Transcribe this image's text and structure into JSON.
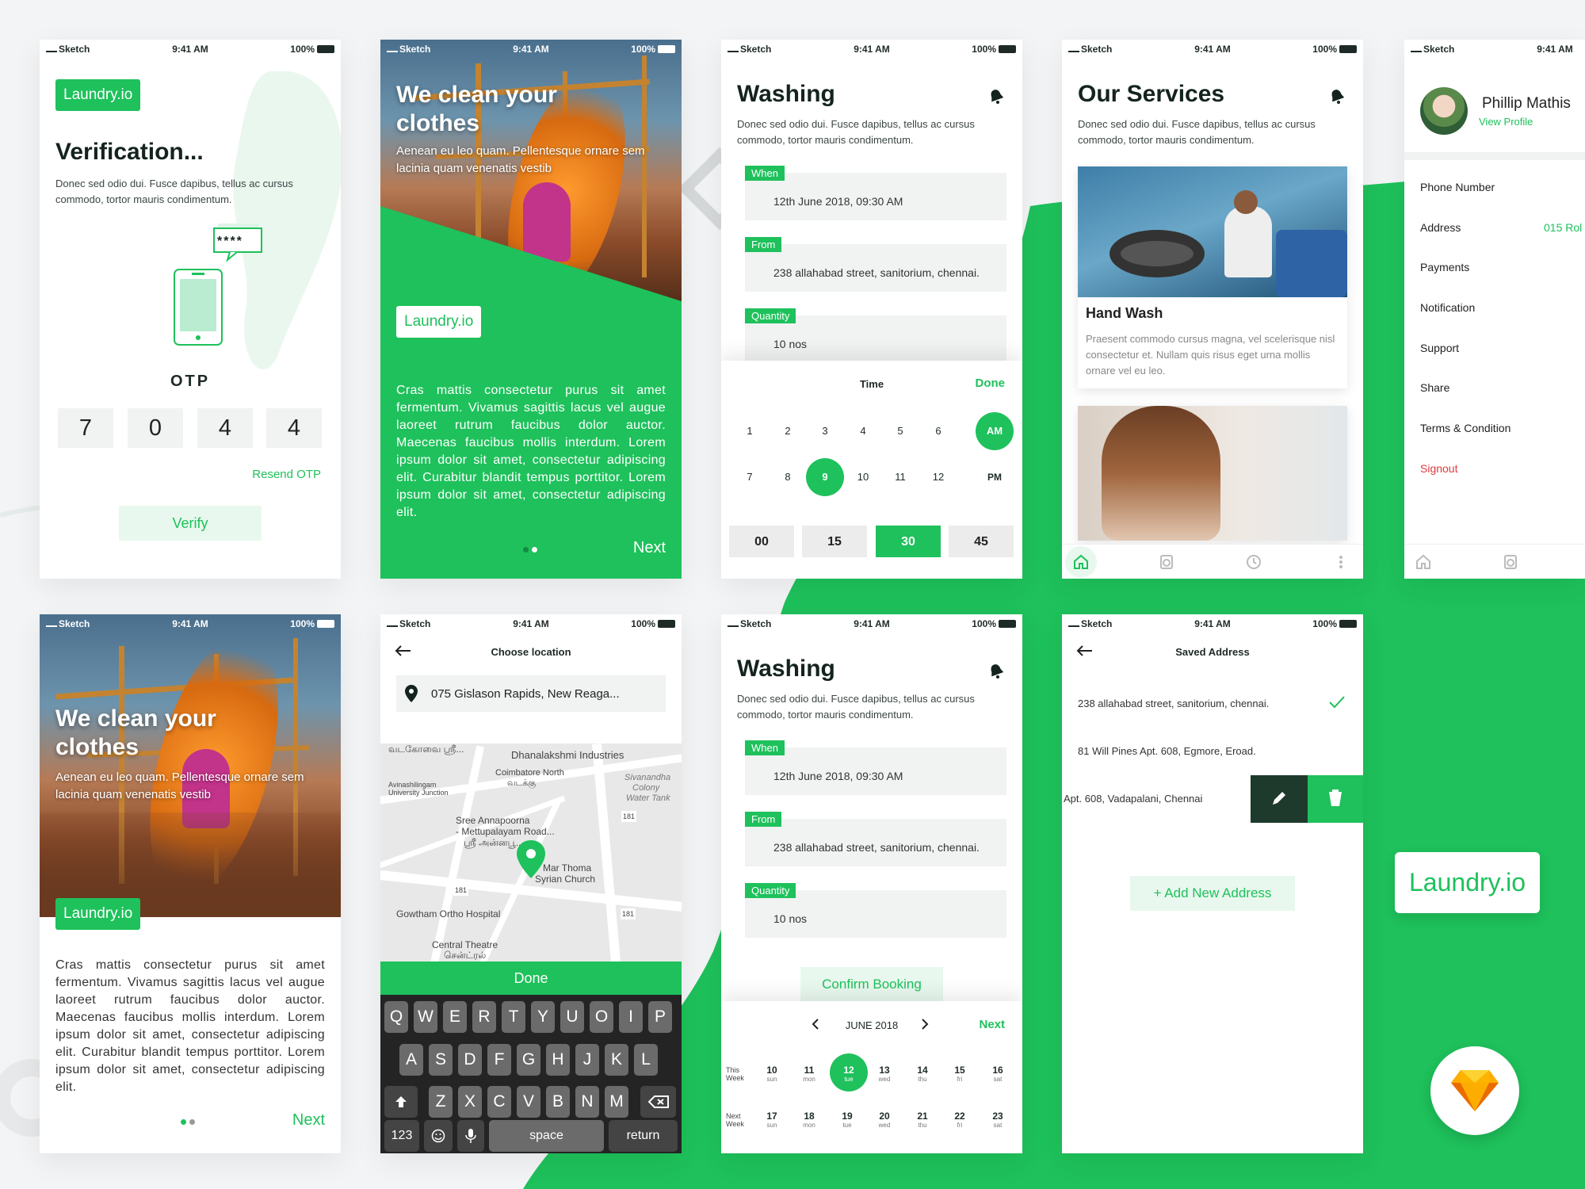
{
  "status_bar": {
    "carrier": "Sketch",
    "time": "9:41 AM",
    "battery": "100%"
  },
  "brand": {
    "logo": "Laundry.io",
    "accent": "#1ec15b",
    "dark": "#14231f"
  },
  "lorem_short": "Donec sed odio dui. Fusce dapibus, tellus ac cursus commodo, tortor mauris condimentum.",
  "lorem_long": "Cras mattis consectetur purus sit amet fermentum. Vivamus sagittis lacus vel augue laoreet rutrum faucibus dolor auctor. Maecenas faucibus mollis interdum. Lorem ipsum dolor sit amet, consectetur adipiscing elit. Curabitur blandit tempus porttitor. Lorem ipsum dolor sit amet, consectetur adipiscing elit.",
  "verification": {
    "title": "Verification...",
    "otp_label": "OTP",
    "otp_icon": "****",
    "digits": [
      "7",
      "0",
      "4",
      "4"
    ],
    "resend": "Resend OTP",
    "verify": "Verify"
  },
  "onboarding": {
    "title_line1": "We clean your",
    "title_line2": "clothes",
    "subtitle": "Aenean eu leo quam. Pellentesque ornare sem lacinia quam venenatis vestib",
    "next": "Next"
  },
  "booking": {
    "title": "Washing",
    "when_label": "When",
    "when_value": "12th June 2018, 09:30 AM",
    "from_label": "From",
    "from_value": "238 allahabad street,  sanitorium, chennai.",
    "qty_label": "Quantity",
    "qty_value": "10 nos",
    "time_title": "Time",
    "done": "Done",
    "hours_row1": [
      "1",
      "2",
      "3",
      "4",
      "5",
      "6"
    ],
    "hours_row2": [
      "7",
      "8",
      "9",
      "10",
      "11",
      "12"
    ],
    "am": "AM",
    "pm": "PM",
    "minutes": [
      "00",
      "15",
      "30",
      "45"
    ],
    "confirm": "Confirm Booking",
    "month": "JUNE 2018",
    "next": "Next",
    "week1_label_a": "This",
    "week1_label_b": "Week",
    "week2_label_a": "Next",
    "week2_label_b": "Week",
    "week1": [
      {
        "d": "10",
        "w": "sun"
      },
      {
        "d": "11",
        "w": "mon"
      },
      {
        "d": "12",
        "w": "tue"
      },
      {
        "d": "13",
        "w": "wed"
      },
      {
        "d": "14",
        "w": "thu"
      },
      {
        "d": "15",
        "w": "fri"
      },
      {
        "d": "16",
        "w": "sat"
      }
    ],
    "week2": [
      {
        "d": "17",
        "w": "sun"
      },
      {
        "d": "18",
        "w": "mon"
      },
      {
        "d": "19",
        "w": "tue"
      },
      {
        "d": "20",
        "w": "wed"
      },
      {
        "d": "21",
        "w": "thu"
      },
      {
        "d": "22",
        "w": "fri"
      },
      {
        "d": "23",
        "w": "sat"
      }
    ]
  },
  "services": {
    "title": "Our Services",
    "card_title": "Hand Wash",
    "card_desc": "Praesent commodo cursus magna, vel scelerisque nisl consectetur et. Nullam quis risus eget urna mollis ornare vel eu leo."
  },
  "profile": {
    "name": "Phillip Mathis",
    "view": "View Profile",
    "menu": [
      "Phone Number",
      "Address",
      "Payments",
      "Notification",
      "Support",
      "Share",
      "Terms & Condition"
    ],
    "address_value": "015 Rol",
    "signout": "Signout"
  },
  "location": {
    "title": "Choose location",
    "search_value": "075 Gislason Rapids, New Reaga...",
    "done": "Done",
    "map_labels": [
      "வடகோவை ஸ்ரீ...",
      "Dhanalakshmi Industries",
      "Avinashilingam",
      "University Junction",
      "Coimbatore North",
      "வடக்கு",
      "Sivanandha",
      "Colony",
      "Water Tank",
      "Sree Annapoorna",
      "- Mettupalayam Road...",
      "ஸ்ரீ அன்னபூ...",
      "Mar Thoma",
      "Syrian Church",
      "Gowtham Ortho Hospital",
      "Central Theatre",
      "சென்ட்ரல்",
      "181",
      "181",
      "181"
    ],
    "keys_row1": [
      "Q",
      "W",
      "E",
      "R",
      "T",
      "Y",
      "U",
      "O",
      "I",
      "P"
    ],
    "keys_row2": [
      "A",
      "S",
      "D",
      "F",
      "G",
      "H",
      "J",
      "K",
      "L"
    ],
    "keys_row3": [
      "Z",
      "X",
      "C",
      "V",
      "B",
      "N",
      "M"
    ],
    "key_123": "123",
    "key_space": "space",
    "key_return": "return"
  },
  "saved": {
    "title": "Saved Address",
    "addresses": [
      "238 allahabad street,  sanitorium, chennai.",
      "81 Will Pines Apt. 608, Egmore, Eroad.",
      "Apt. 608, Vadapalani, Chennai"
    ],
    "add": "+ Add New Address"
  }
}
